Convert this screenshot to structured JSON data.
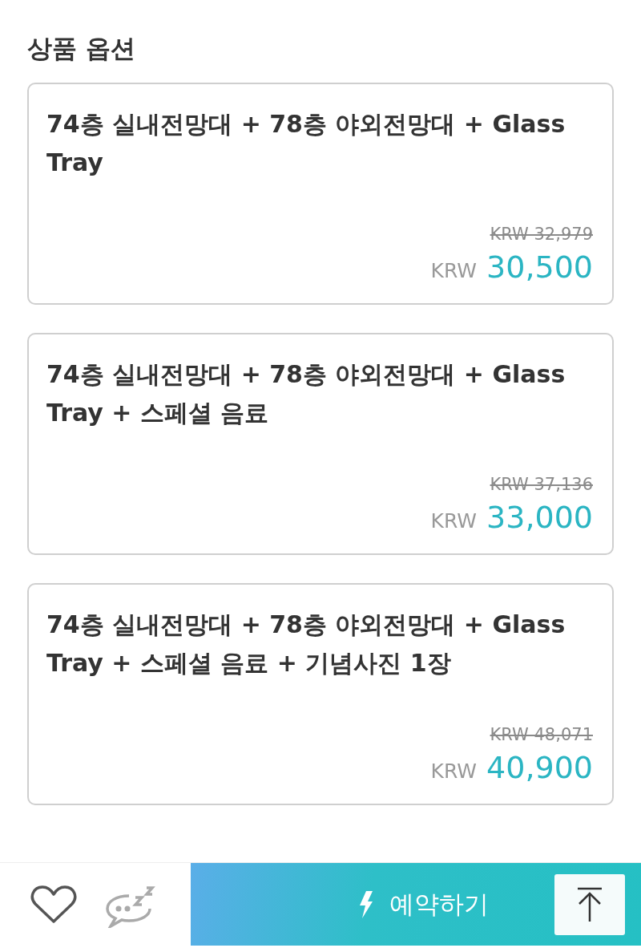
{
  "section_title": "상품 옵션",
  "options": [
    {
      "name": "74층 실내전망대 + 78층 야외전망대 + Glass Tray",
      "original_price": "KRW 32,979",
      "currency": "KRW",
      "price": "30,500"
    },
    {
      "name": "74층 실내전망대 + 78층 야외전망대 + Glass Tray + 스페셜 음료",
      "original_price": "KRW 37,136",
      "currency": "KRW",
      "price": "33,000"
    },
    {
      "name": "74층 실내전망대 + 78층 야외전망대 + Glass Tray + 스페셜 음료 + 기념사진 1장",
      "original_price": "KRW 48,071",
      "currency": "KRW",
      "price": "40,900"
    }
  ],
  "bottom_bar": {
    "book_button": "예약하기"
  }
}
